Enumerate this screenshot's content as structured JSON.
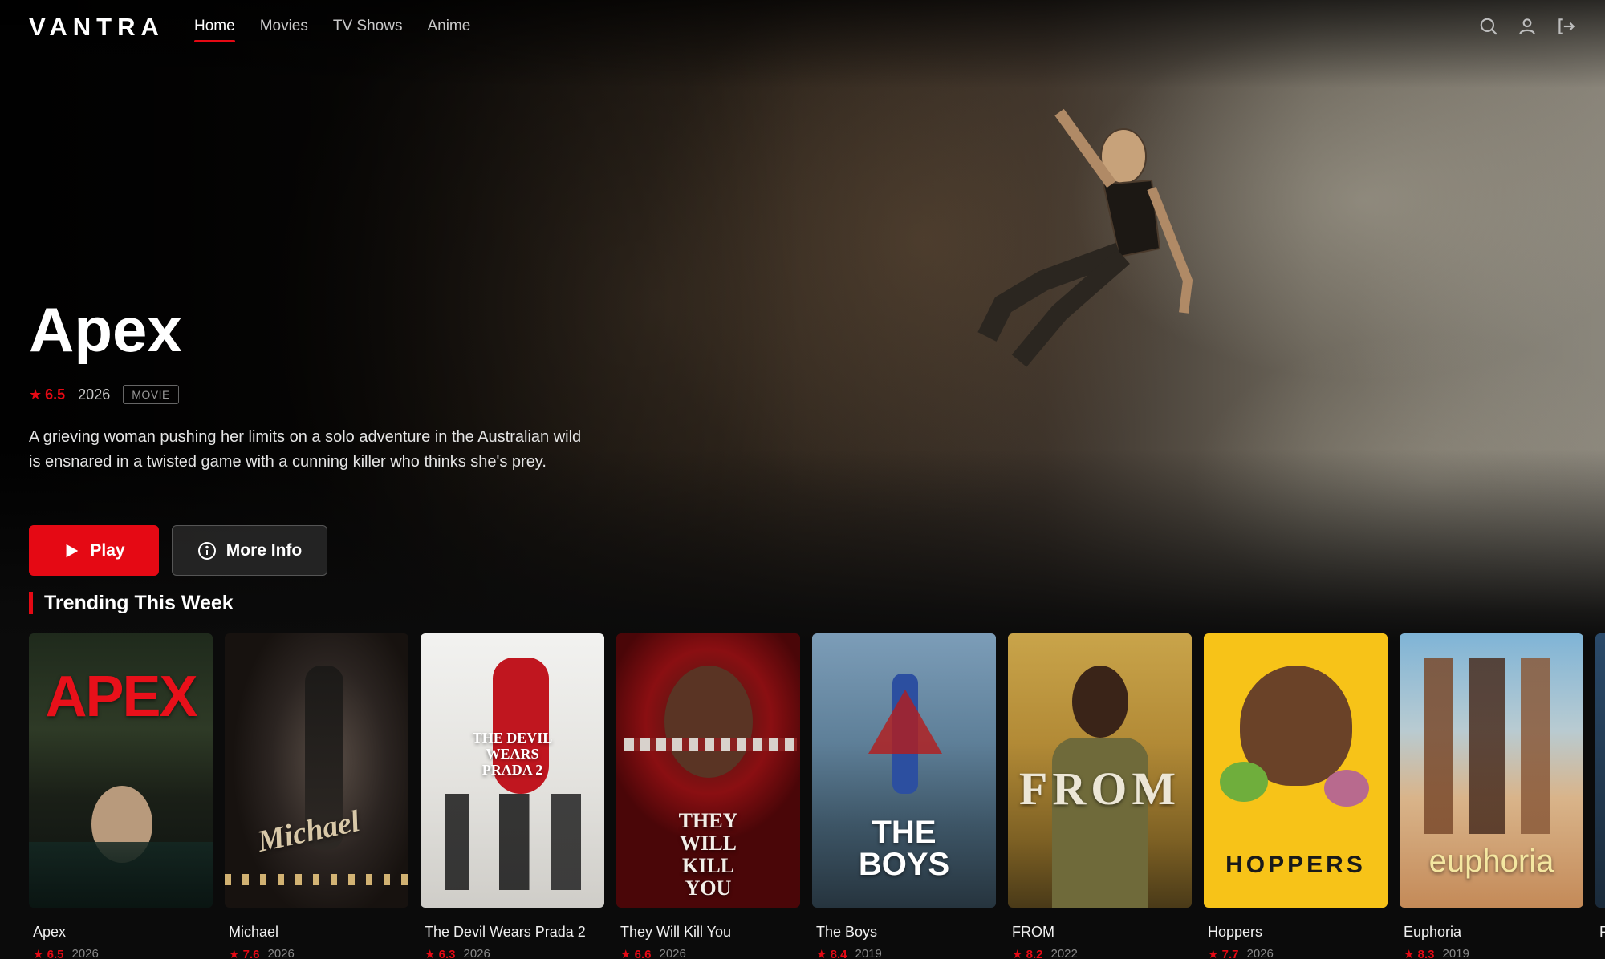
{
  "nav": {
    "logo": "VANTRA",
    "links": [
      "Home",
      "Movies",
      "TV Shows",
      "Anime"
    ],
    "active": "Home"
  },
  "featured": {
    "title": "Apex",
    "rating": "6.5",
    "year": "2026",
    "type_badge": "MOVIE",
    "description": "A grieving woman pushing her limits on a solo adventure in the Australian wild is ensnared in a twisted game with a cunning killer who thinks she's prey.",
    "play_label": "Play",
    "info_label": "More Info"
  },
  "section_title": "Trending This Week",
  "cards": [
    {
      "title": "Apex",
      "rating": "6.5",
      "year": "2026",
      "poster_text": "APEX"
    },
    {
      "title": "Michael",
      "rating": "7.6",
      "year": "2026",
      "poster_text": "Michael"
    },
    {
      "title": "The Devil Wears Prada 2",
      "rating": "6.3",
      "year": "2026",
      "poster_text": "THE DEVIL WEARS PRADA 2"
    },
    {
      "title": "They Will Kill You",
      "rating": "6.6",
      "year": "2026",
      "poster_text": "THEY WILL KILL YOU"
    },
    {
      "title": "The Boys",
      "rating": "8.4",
      "year": "2019",
      "poster_text": "THE BOYS"
    },
    {
      "title": "FROM",
      "rating": "8.2",
      "year": "2022",
      "poster_text": "FROM"
    },
    {
      "title": "Hoppers",
      "rating": "7.7",
      "year": "2026",
      "poster_text": "HOPPERS"
    },
    {
      "title": "Euphoria",
      "rating": "8.3",
      "year": "2019",
      "poster_text": "euphoria"
    },
    {
      "title": "P",
      "rating": "",
      "year": "",
      "poster_text": ""
    }
  ],
  "colors": {
    "accent": "#e50914",
    "background": "#0b0b0b"
  },
  "icons": [
    "search-icon",
    "user-icon",
    "logout-icon",
    "play-icon",
    "info-icon",
    "star-icon"
  ]
}
